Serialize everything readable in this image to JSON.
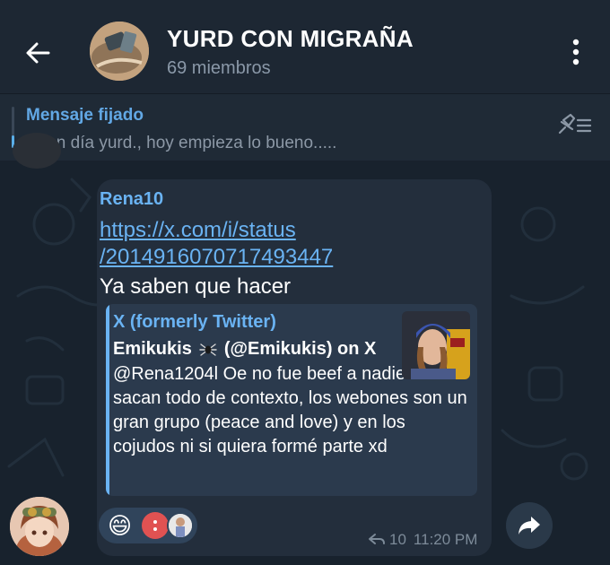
{
  "header": {
    "title": "YURD CON MIGRAÑA",
    "subtitle": "69 miembros",
    "back_icon": "arrow-left-icon",
    "menu_icon": "kebab-menu-icon"
  },
  "pinned": {
    "label": "Mensaje fijado",
    "text": "Buen día yurd., hoy empieza lo bueno.....",
    "icon": "pin-list-icon"
  },
  "message": {
    "sender": "Rena10",
    "link_line1": "https://x.com/i/status",
    "link_line2": "/2014916070717493447",
    "text": "Ya saben que hacer",
    "preview": {
      "site": "X (formerly Twitter)",
      "title_pre": "Emikukis",
      "title_post": "(@Emikukis) on X",
      "description": "@Rena1204l Oe no fue beef a nadie como sacan todo de contexto, los webones son un gran grupo (peace and love) y en los cojudos ni si quiera formé parte xd"
    },
    "reactions": {
      "emoji": "😄"
    },
    "views": "10",
    "time": "11:20 PM"
  },
  "colors": {
    "background": "#18222d",
    "header": "#1d2733",
    "bubble": "#232e3c",
    "accent": "#6ab3f3",
    "muted": "#7d8b99"
  }
}
